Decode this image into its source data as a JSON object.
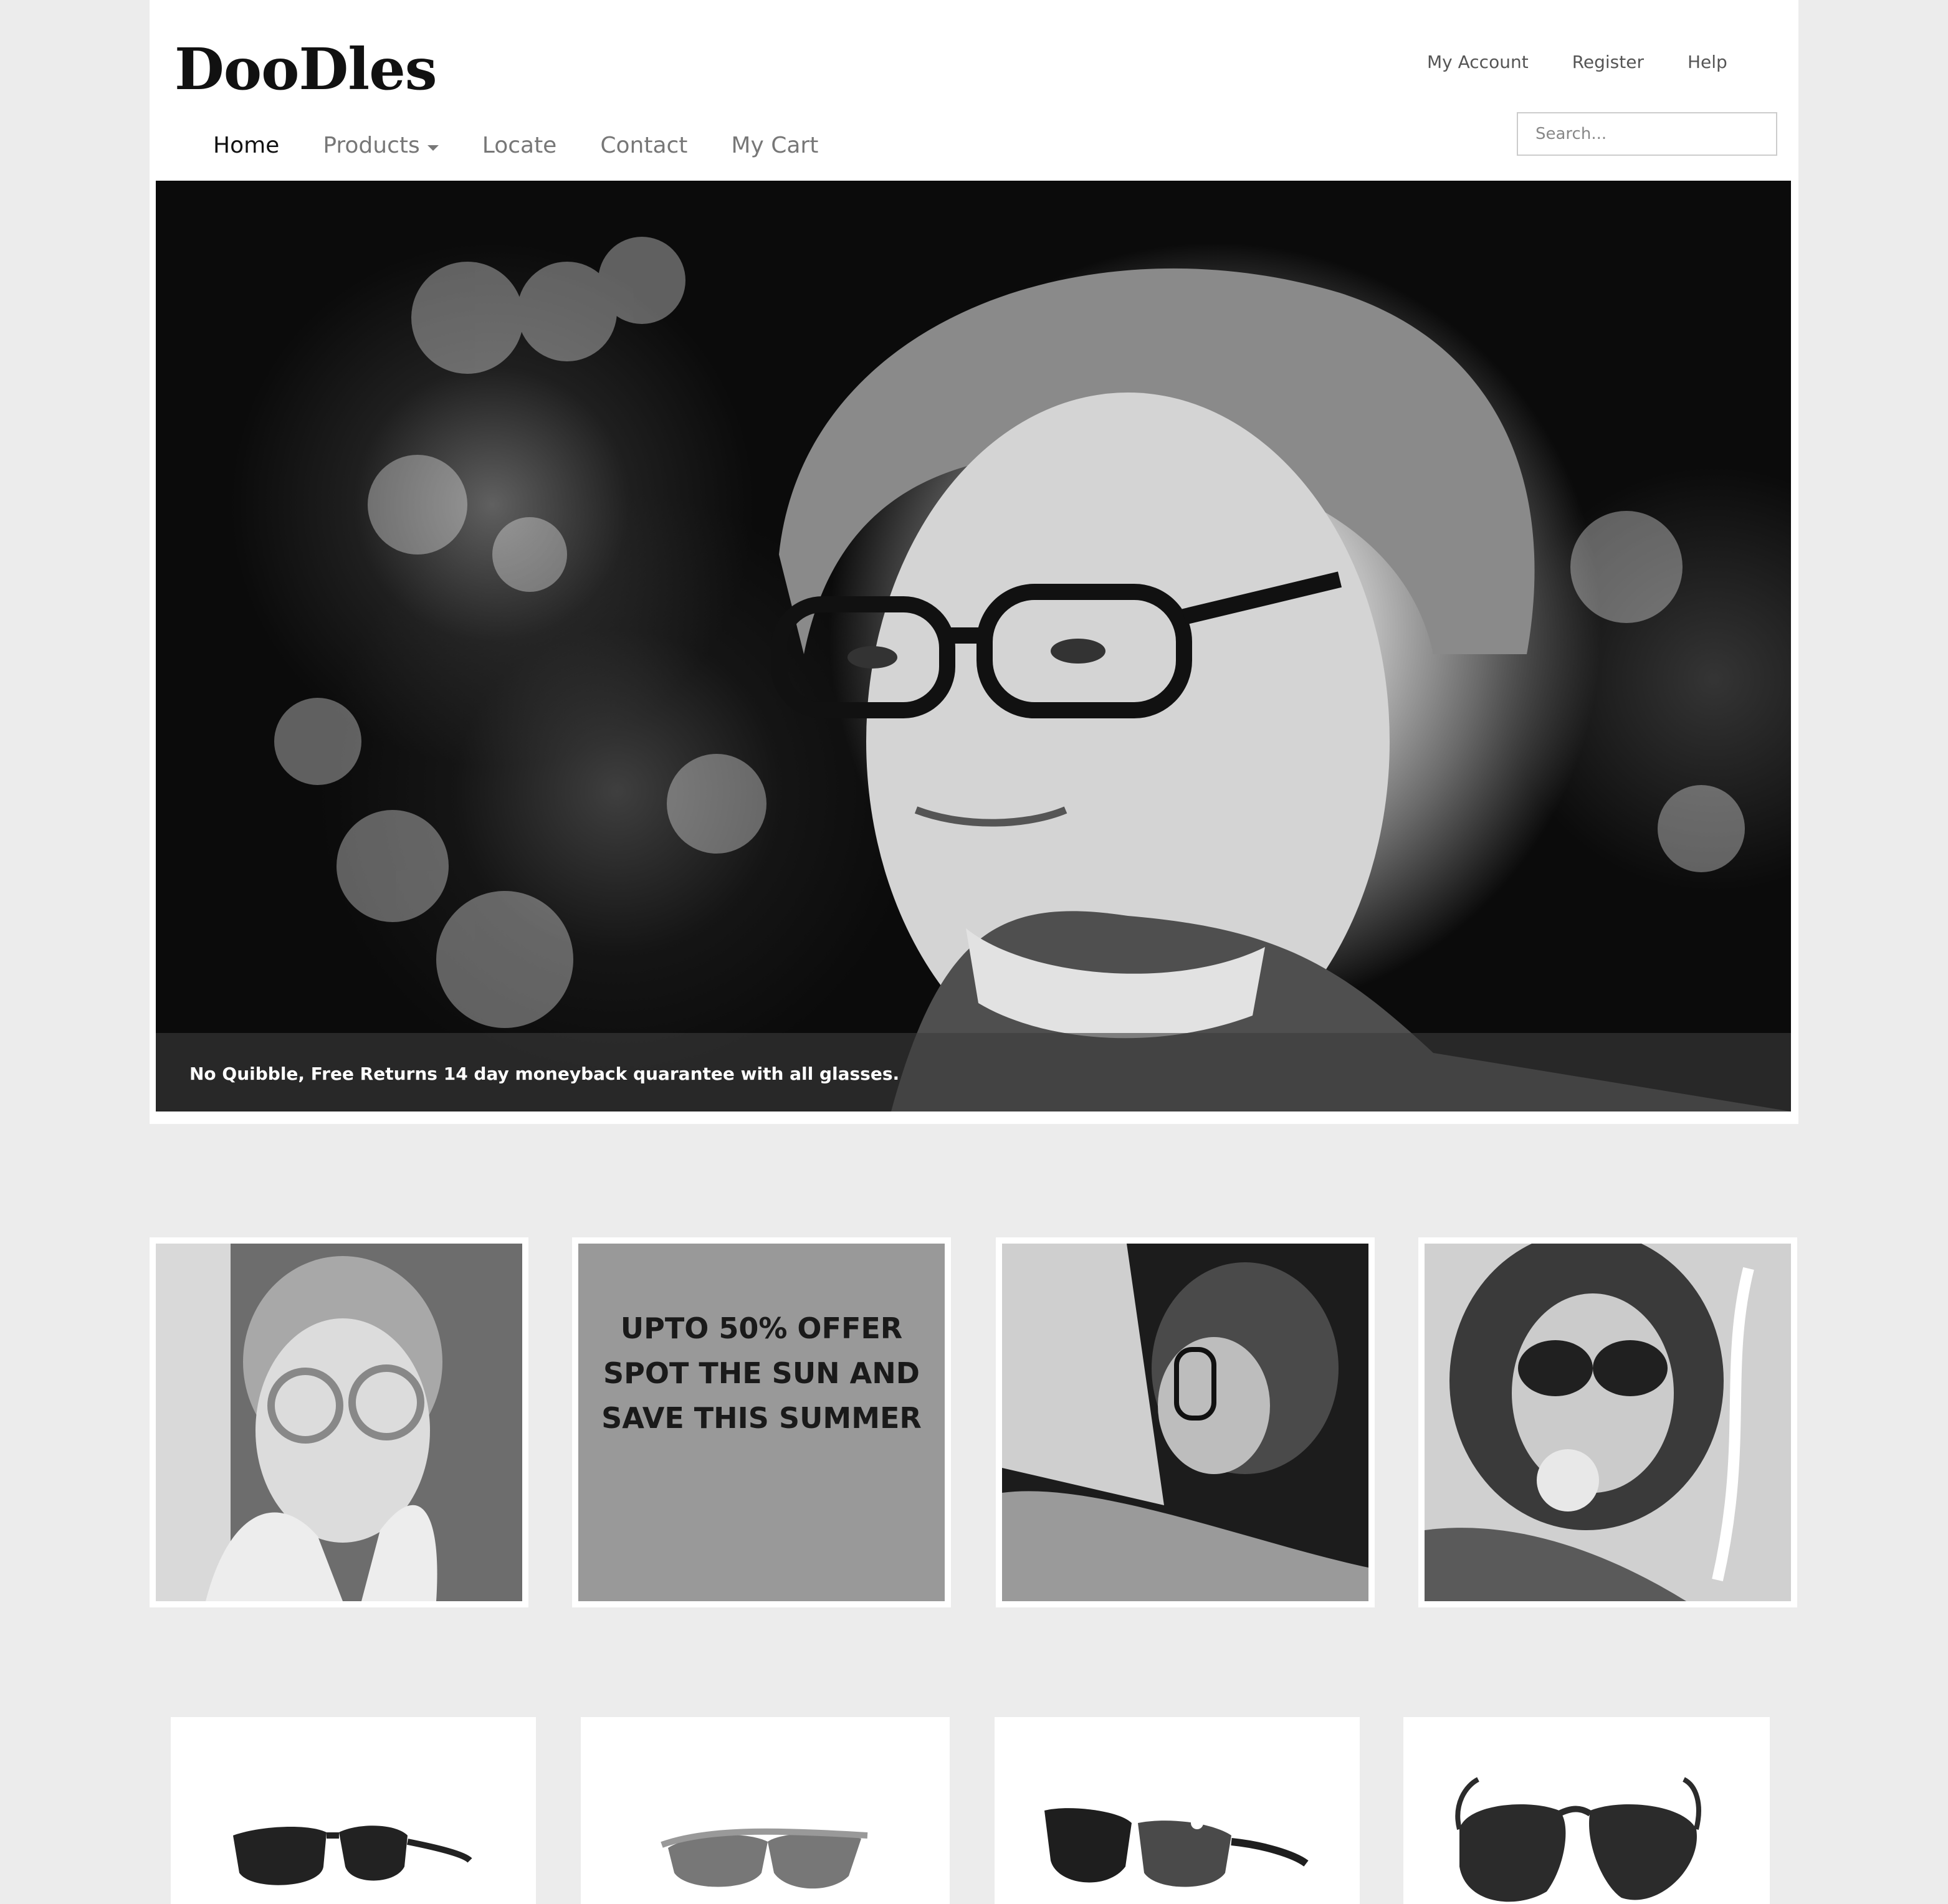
{
  "brand": {
    "logo_text": "DooDles"
  },
  "top_links": {
    "account": "My Account",
    "register": "Register",
    "help": "Help"
  },
  "nav": {
    "home": "Home",
    "products": "Products",
    "locate": "Locate",
    "contact": "Contact",
    "cart": "My Cart"
  },
  "search": {
    "placeholder": "Search...",
    "value": ""
  },
  "hero": {
    "caption": "No Quibble, Free Returns 14 day moneyback quarantee with all glasses."
  },
  "promo": {
    "line1": "UPTO 50% OFFER",
    "line2": "SPOT THE SUN AND",
    "line3": "SAVE THIS SUMMER"
  },
  "colors": {
    "page_background": "#ececec",
    "card_background": "#ffffff",
    "promo_tile": "#999999",
    "nav_active": "#111111",
    "nav_inactive": "#777777"
  },
  "icons": {
    "products_dropdown": "caret-down-icon"
  }
}
